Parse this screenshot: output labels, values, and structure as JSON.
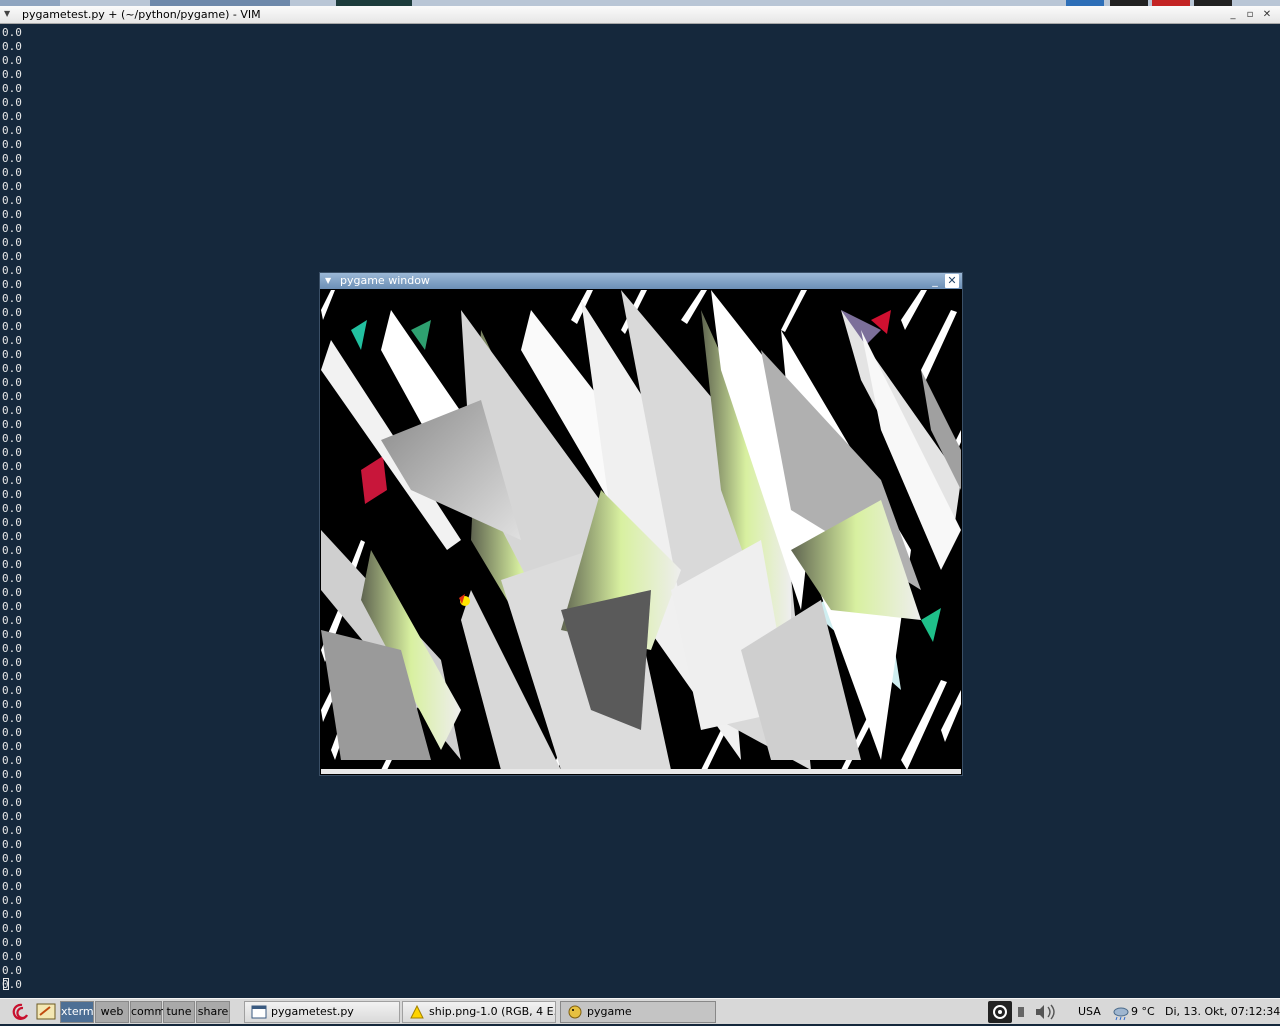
{
  "vim": {
    "title": "pygametest.py + (~/python/pygame) - VIM",
    "lines": [
      "0.0",
      "0.0",
      "0.0",
      "0.0",
      "0.0",
      "0.0",
      "0.0",
      "0.0",
      "0.0",
      "0.0",
      "0.0",
      "0.0",
      "0.0",
      "0.0",
      "0.0",
      "0.0",
      "0.0",
      "0.0",
      "0.0",
      "0.0",
      "0.0",
      "0.0",
      "0.0",
      "0.0",
      "0.0",
      "0.0",
      "0.0",
      "0.0",
      "0.0",
      "0.0",
      "0.0",
      "0.0",
      "0.0",
      "0.0",
      "0.0",
      "0.0",
      "0.0",
      "0.0",
      "0.0",
      "0.0",
      "0.0",
      "0.0",
      "0.0",
      "0.0",
      "0.0",
      "0.0",
      "0.0",
      "0.0",
      "0.0",
      "0.0",
      "0.0",
      "0.0",
      "0.0",
      "0.0",
      "0.0",
      "0.0",
      "0.0",
      "0.0",
      "0.0",
      "0.0",
      "0.0",
      "0.0",
      "0.0",
      "0.0",
      "0.0",
      "0.0",
      "0.0",
      "0.0",
      "0.0"
    ],
    "window_buttons": {
      "minimize": "_",
      "maximize": "▫",
      "close": "✕"
    }
  },
  "pygame_window": {
    "title": "pygame window",
    "buttons": {
      "minimize": "_",
      "close": "✕"
    }
  },
  "taskbar": {
    "desktops": [
      "xterm",
      "web",
      "comm",
      "tune",
      "share"
    ],
    "active_desktop": "xterm",
    "tasks": [
      {
        "label": "pygametest.py",
        "icon": "window-icon"
      },
      {
        "label": "ship.png-1.0 (RGB, 4 E...",
        "icon": "image-editor-icon"
      },
      {
        "label": "pygame",
        "icon": "python-snake-icon",
        "active": true
      }
    ],
    "tray": {
      "keyboard_layout": "USA",
      "weather": "9 °C",
      "clock": "Di, 13. Okt, 07:12:34"
    }
  },
  "colors": {
    "terminal_bg": "#15283c",
    "terminal_fg": "#e8e8e8",
    "titlebar_active": "#7896ba",
    "desktop_active": "#4d6f95"
  }
}
